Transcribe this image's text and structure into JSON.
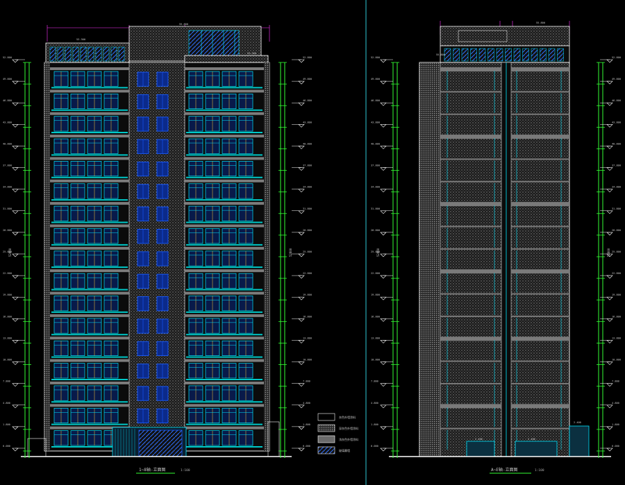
{
  "colors": {
    "background": "#000000",
    "outline": "#ffffff",
    "window_frame": "#00e5ff",
    "window_glass": "#1a5cff",
    "floor_band": "#00c8c8",
    "wall_hatch": "#6a6a6a",
    "dim_green": "#33ff33",
    "level_magenta": "#ff33ff",
    "grid_red": "#ff3333",
    "curtain_yellow": "#ffcc33",
    "divider": "#2ec7d6",
    "label": "#cccccc"
  },
  "left_elevation": {
    "title": "1~8轴-立面图",
    "scale": "1:100",
    "roof_top_level": "55.800",
    "stair_roof_level": "53.300",
    "level_tags": [
      "52.800",
      "49.800",
      "46.800",
      "43.800",
      "40.800",
      "37.800",
      "34.800",
      "31.800",
      "28.800",
      "25.800",
      "22.800",
      "19.800",
      "16.800",
      "13.800",
      "10.800",
      "7.800",
      "4.800",
      "1.800",
      "0.000"
    ],
    "height_dim": "52800",
    "floor_count": 17
  },
  "right_elevation": {
    "title": "A~E轴-立面图",
    "scale": "1:100",
    "roof_top_level": "55.800",
    "level_tags": [
      "52.800",
      "49.800",
      "46.800",
      "43.800",
      "40.800",
      "37.800",
      "34.800",
      "31.800",
      "28.800",
      "25.800",
      "22.800",
      "19.800",
      "16.800",
      "13.800",
      "10.800",
      "7.800",
      "4.800",
      "1.800",
      "0.000"
    ],
    "height_dim": "52800",
    "entrance_labels": [
      "2.400",
      "2.400"
    ],
    "floor_count": 17
  },
  "legend": {
    "items": [
      {
        "pattern": "plain",
        "label": "灰色外墙涂料"
      },
      {
        "pattern": "dots",
        "label": "深灰色外墙涂料"
      },
      {
        "pattern": "gray",
        "label": "浅灰色外墙涂料"
      },
      {
        "pattern": "diag",
        "label": "玻璃幕墙"
      }
    ]
  },
  "icons": [
    "north-arrow-icon"
  ]
}
